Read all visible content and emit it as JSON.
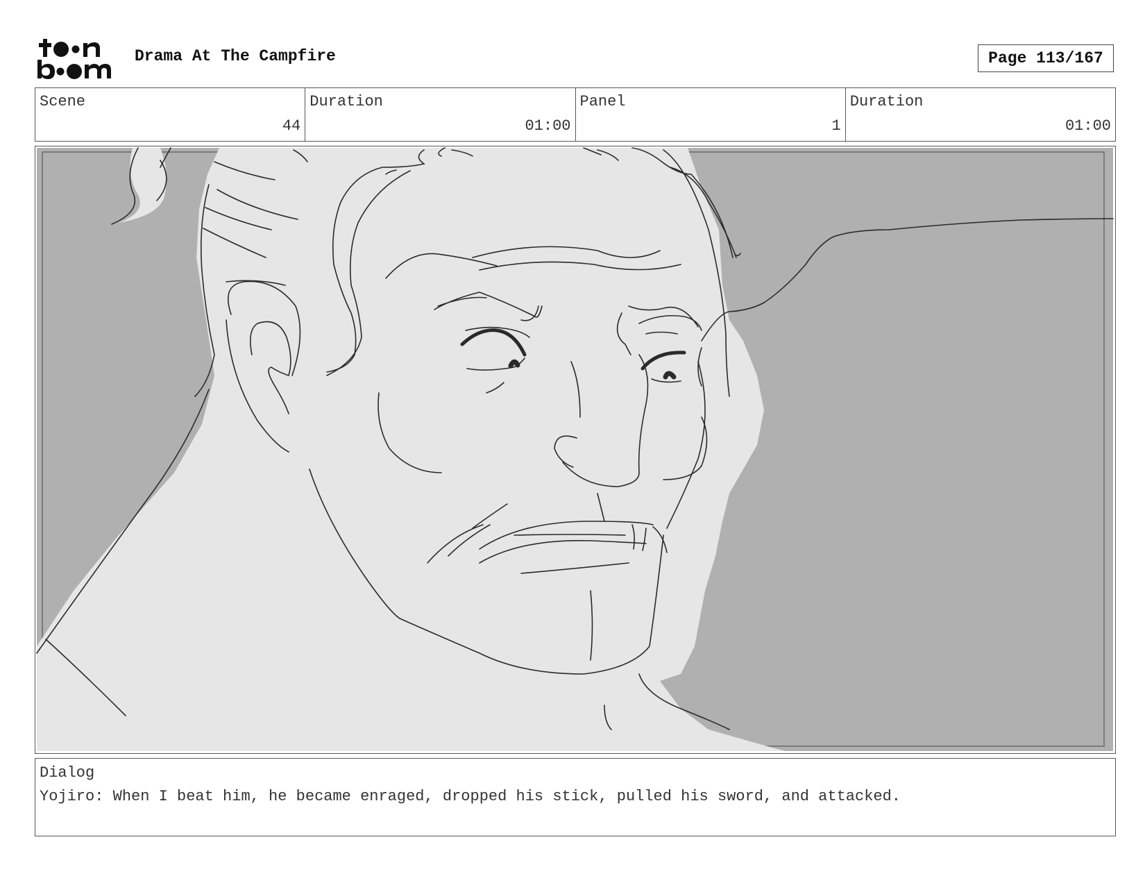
{
  "header": {
    "logo_text": "toon boom",
    "project_title": "Drama At The Campfire",
    "page_indicator": "Page 113/167"
  },
  "info": {
    "scene_label": "Scene",
    "scene_value": "44",
    "scene_duration_label": "Duration",
    "scene_duration_value": "01:00",
    "panel_label": "Panel",
    "panel_value": "1",
    "panel_duration_label": "Duration",
    "panel_duration_value": "01:00"
  },
  "panel": {
    "background_color": "#b0b0b0",
    "figure_fill_color": "#e6e6e6",
    "line_color": "#2a2a2a"
  },
  "dialog": {
    "label": "Dialog",
    "text": "Yojiro: When I beat him, he became enraged, dropped his stick, pulled his sword, and attacked."
  }
}
